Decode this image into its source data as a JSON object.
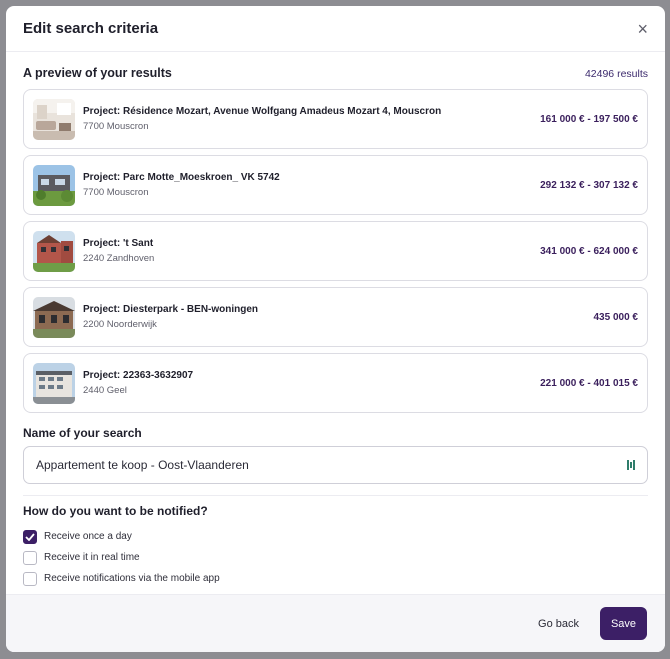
{
  "modal": {
    "title": "Edit search criteria",
    "close_label": "×"
  },
  "preview": {
    "heading": "A preview of your results",
    "count": "42496 results",
    "cards": [
      {
        "title": "Project: Résidence Mozart, Avenue Wolfgang Amadeus Mozart 4, Mouscron",
        "location": "7700 Mouscron",
        "price": "161 000 € - 197 500 €",
        "image": "interior-living-room"
      },
      {
        "title": "Project: Parc Motte_Moeskroen_ VK 5742",
        "location": "7700 Mouscron",
        "price": "292 132 € - 307 132 €",
        "image": "modern-house-garden"
      },
      {
        "title": "Project: 't Sant",
        "location": "2240 Zandhoven",
        "price": "341 000 € - 624 000 €",
        "image": "brick-houses"
      },
      {
        "title": "Project: Diesterpark - BEN-woningen",
        "location": "2200 Noorderwijk",
        "price": "435 000 €",
        "image": "row-houses"
      },
      {
        "title": "Project: 22363-3632907",
        "location": "2440 Geel",
        "price": "221 000 € - 401 015 €",
        "image": "apartment-building"
      }
    ]
  },
  "search_name": {
    "label": "Name of your search",
    "value": "Appartement te koop - Oost-Vlaanderen"
  },
  "notifications": {
    "heading": "How do you want to be notified?",
    "options": [
      {
        "label": "Receive once a day",
        "checked": true
      },
      {
        "label": "Receive it in real time",
        "checked": false
      },
      {
        "label": "Receive notifications via the mobile app",
        "checked": false
      }
    ]
  },
  "footer": {
    "back_label": "Go back",
    "save_label": "Save"
  },
  "colors": {
    "accent": "#3c1f66",
    "price": "#3a1f5c"
  }
}
